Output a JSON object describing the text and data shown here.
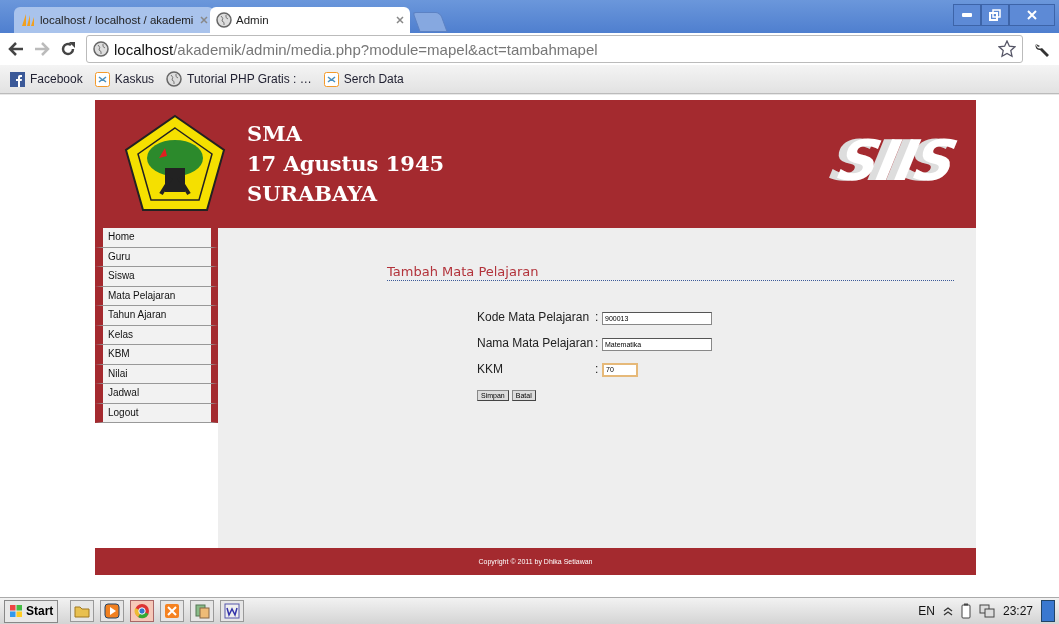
{
  "browser": {
    "tabs": [
      {
        "title": "localhost / localhost / akademi",
        "selected": false,
        "kind": "pma"
      },
      {
        "title": "Admin",
        "selected": true,
        "kind": "globe"
      }
    ],
    "address": {
      "host": "localhost",
      "path": "/akademik/admin/media.php?module=mapel&act=tambahmapel"
    },
    "bookmarks": [
      {
        "label": "Facebook",
        "kind": "facebook"
      },
      {
        "label": "Kaskus",
        "kind": "kaskus"
      },
      {
        "label": "Tutorial PHP Gratis : …",
        "kind": "globe"
      },
      {
        "label": "Serch Data",
        "kind": "kaskus"
      }
    ]
  },
  "header": {
    "lines": [
      "SMA",
      "17 Agustus 1945",
      "SURABAYA"
    ],
    "logo_text": "SIIS"
  },
  "menu": [
    "Home",
    "Guru",
    "Siswa",
    "Mata Pelajaran",
    "Tahun Ajaran",
    "Kelas",
    "KBM",
    "Nilai",
    "Jadwal",
    "Logout"
  ],
  "form": {
    "title": "Tambah Mata Pelajaran",
    "fields": [
      {
        "label": "Kode Mata Pelajaran",
        "separator": ":",
        "value": "900013",
        "focused": false,
        "kind": "text"
      },
      {
        "label": "Nama Mata Pelajaran",
        "separator": ":",
        "value": "Matematika",
        "focused": false,
        "kind": "text"
      },
      {
        "label": "KKM",
        "separator": ":",
        "value": "70",
        "focused": true,
        "kind": "number"
      }
    ],
    "buttons": [
      "Simpan",
      "Batal"
    ]
  },
  "footer": "Copyright © 2011 by Dhika Setiawan",
  "taskbar": {
    "start": "Start",
    "apps": [
      {
        "kind": "folder",
        "selected": false
      },
      {
        "kind": "media",
        "selected": false
      },
      {
        "kind": "chrome",
        "selected": true
      },
      {
        "kind": "xampp",
        "selected": false
      },
      {
        "kind": "files",
        "selected": false
      },
      {
        "kind": "word",
        "selected": false
      }
    ],
    "language": "EN",
    "time": "23:27"
  }
}
